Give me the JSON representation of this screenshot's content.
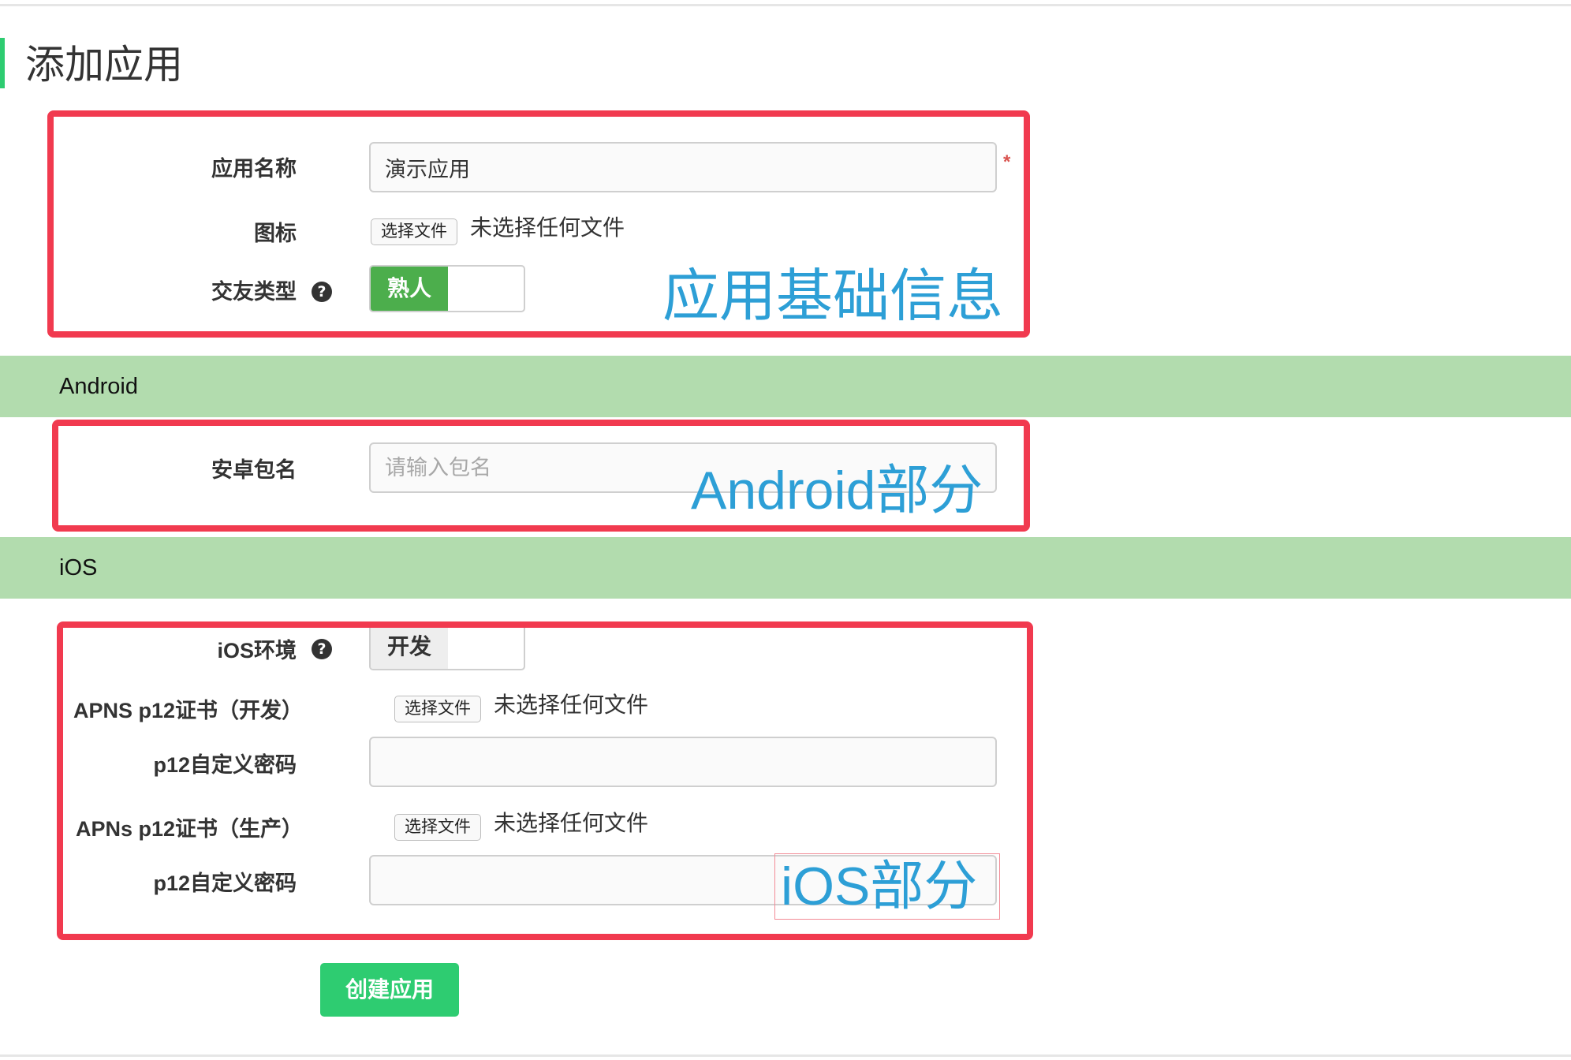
{
  "page": {
    "title": "添加应用"
  },
  "basic": {
    "app_name_label": "应用名称",
    "app_name_value": "演示应用",
    "required_mark": "*",
    "icon_label": "图标",
    "file_button": "选择文件",
    "no_file_text": "未选择任何文件",
    "friend_type_label": "交友类型",
    "help_icon": "?",
    "friend_type_value": "熟人"
  },
  "android": {
    "section_title": "Android",
    "package_label": "安卓包名",
    "package_placeholder": "请输入包名"
  },
  "ios": {
    "section_title": "iOS",
    "env_label": "iOS环境",
    "help_icon": "?",
    "env_value": "开发",
    "apns_dev_label": "APNS p12证书（开发）",
    "apns_prod_label": "APNs p12证书（生产）",
    "file_button": "选择文件",
    "no_file_text": "未选择任何文件",
    "p12_password_label": "p12自定义密码"
  },
  "annotations": {
    "basic": "应用基础信息",
    "android": "Android部分",
    "ios": "iOS部分",
    "color_box": "#f13a4f",
    "color_text": "#2d9fd6"
  },
  "actions": {
    "create_label": "创建应用"
  },
  "colors": {
    "accent": "#2ecc71",
    "section_band": "#b2dcae",
    "toggle_on": "#4cae4c"
  }
}
